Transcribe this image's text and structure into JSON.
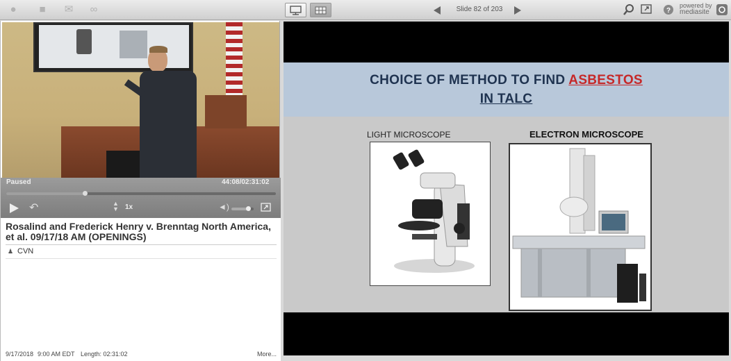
{
  "toolbar": {
    "left_icons": [
      "chapters-icon",
      "comment-icon",
      "mail-icon",
      "link-icon"
    ],
    "slide_counter": "Slide 82 of 203",
    "powered_line1": "powered by",
    "powered_line2": "mediasite"
  },
  "player": {
    "status": "Paused",
    "time": "44:08/02:31:02",
    "speed": "1x",
    "progress": 0.29,
    "volume": 0.75
  },
  "presentation": {
    "title": "Rosalind and Frederick Henry v. Brenntag North America, et al. 09/17/18 AM (OPENINGS)",
    "presenter": "CVN",
    "date": "9/17/2018",
    "time": "9:00 AM EDT",
    "length": "Length: 02:31:02",
    "more": "More..."
  },
  "slide": {
    "title_line1_prefix": "CHOICE OF METHOD TO FIND ",
    "title_line1_highlight": "ASBESTOS",
    "title_line2": "IN TALC",
    "left_caption": "LIGHT MICROSCOPE",
    "right_caption": "ELECTRON MICROSCOPE"
  },
  "colors": {
    "title_text": "#1f3350",
    "highlight": "#c62828",
    "title_band": "#b8c8da"
  }
}
